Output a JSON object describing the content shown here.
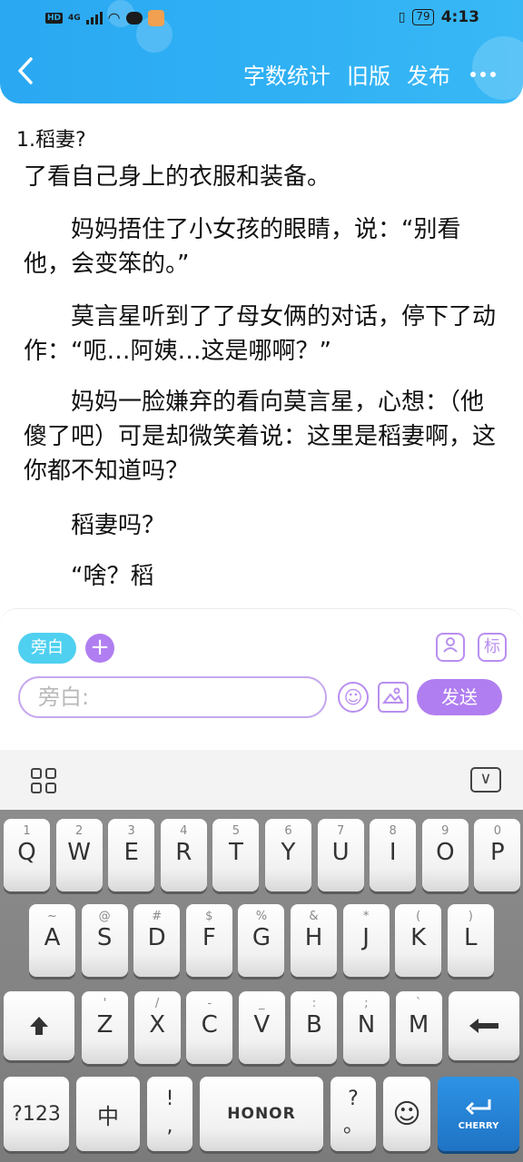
{
  "status_bar": {
    "network": "HD",
    "signal": "4G",
    "battery": "79",
    "time": "4:13"
  },
  "nav": {
    "back_icon": "chevron-left-icon",
    "word_count": "字数统计",
    "old_version": "旧版",
    "publish": "发布",
    "more_icon": "more-dots-icon"
  },
  "content": {
    "chapter_title": "1.稻妻?",
    "paragraphs": [
      "了看自己身上的衣服和装备。",
      "　　妈妈捂住了小女孩的眼睛，说：“别看他，会变笨的。”",
      "　　莫言星听到了了母女俩的对话，停下了动作：“呃…阿姨…这是哪啊？”",
      "　　妈妈一脸嫌弃的看向莫言星，心想：（他傻了吧）可是却微笑着说：这里是稻妻啊，这你都不知道吗？",
      "　　稻妻吗？",
      "　　“啥？稻"
    ]
  },
  "composer": {
    "role_chip": "旁白",
    "add_icon": "plus-icon",
    "character_icon": "character-card-icon",
    "tag_label": "标",
    "input_placeholder": "旁白:",
    "emoji_icon": "smiley-icon",
    "image_icon": "image-icon",
    "send_label": "发送"
  },
  "keyboard": {
    "toolbar": {
      "menu_icon": "grid-icon",
      "collapse_icon": "collapse-keyboard-icon"
    },
    "row1": [
      {
        "sub": "1",
        "main": "Q"
      },
      {
        "sub": "2",
        "main": "W"
      },
      {
        "sub": "3",
        "main": "E"
      },
      {
        "sub": "4",
        "main": "R"
      },
      {
        "sub": "5",
        "main": "T"
      },
      {
        "sub": "6",
        "main": "Y"
      },
      {
        "sub": "7",
        "main": "U"
      },
      {
        "sub": "8",
        "main": "I"
      },
      {
        "sub": "9",
        "main": "O"
      },
      {
        "sub": "0",
        "main": "P"
      }
    ],
    "row2": [
      {
        "sub": "~",
        "main": "A"
      },
      {
        "sub": "@",
        "main": "S"
      },
      {
        "sub": "#",
        "main": "D"
      },
      {
        "sub": "$",
        "main": "F"
      },
      {
        "sub": "%",
        "main": "G"
      },
      {
        "sub": "&",
        "main": "H"
      },
      {
        "sub": "*",
        "main": "J"
      },
      {
        "sub": "(",
        "main": "K"
      },
      {
        "sub": ")",
        "main": "L"
      }
    ],
    "row3": [
      {
        "sub": "'",
        "main": "Z"
      },
      {
        "sub": "/",
        "main": "X"
      },
      {
        "sub": "-",
        "main": "C"
      },
      {
        "sub": "_",
        "main": "V"
      },
      {
        "sub": ":",
        "main": "B"
      },
      {
        "sub": ";",
        "main": "N"
      },
      {
        "sub": "`",
        "main": "M"
      }
    ],
    "shift_icon": "shift-arrow-icon",
    "backspace_icon": "backspace-icon",
    "symbols": "?123",
    "lang": "中",
    "punct_top": "!",
    "punct_bottom": ",",
    "space_brand": "HONOR",
    "punct2_top": "?",
    "punct2_bottom": "。",
    "emoji_key_icon": "smiley-icon",
    "enter_brand": "CHERRY"
  }
}
